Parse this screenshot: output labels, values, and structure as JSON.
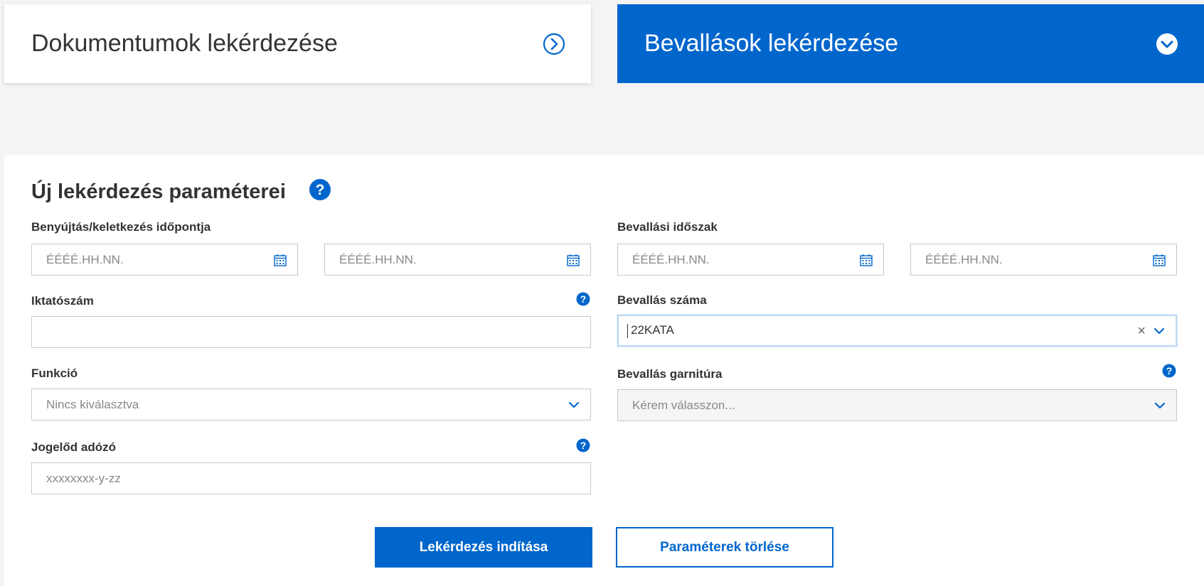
{
  "tiles": {
    "documents": {
      "label": "Dokumentumok lekérdezése",
      "icon": "chevron-right-circle-icon"
    },
    "returns": {
      "label": "Bevallások lekérdezése",
      "icon": "chevron-down-circle-icon"
    }
  },
  "form": {
    "title": "Új lekérdezés paraméterei",
    "submission_date": {
      "label": "Benyújtás/keletkezés időpontja",
      "from_placeholder": "ÉÉÉÉ.HH.NN.",
      "to_placeholder": "ÉÉÉÉ.HH.NN."
    },
    "return_period": {
      "label": "Bevallási időszak",
      "from_placeholder": "ÉÉÉÉ.HH.NN.",
      "to_placeholder": "ÉÉÉÉ.HH.NN."
    },
    "filing_number": {
      "label": "Iktatószám",
      "value": ""
    },
    "return_number": {
      "label": "Bevallás száma",
      "value": "22KATA"
    },
    "function": {
      "label": "Funkció",
      "placeholder": "Nincs kiválasztva"
    },
    "return_set": {
      "label": "Bevallás garnitúra",
      "placeholder": "Kérem válasszon..."
    },
    "predecessor": {
      "label": "Jogelőd adózó",
      "placeholder": "xxxxxxxx-y-zz"
    }
  },
  "buttons": {
    "start": "Lekérdezés indítása",
    "clear": "Paraméterek törlése"
  },
  "colors": {
    "accent": "#0066cc",
    "background": "#f4f4f4"
  }
}
